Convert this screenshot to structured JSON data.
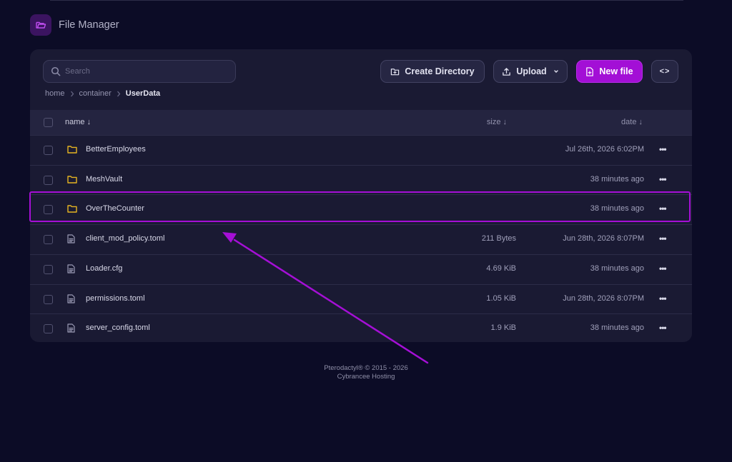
{
  "header": {
    "title": "File Manager",
    "icon": "folder-open-icon"
  },
  "search": {
    "placeholder": "Search",
    "value": ""
  },
  "toolbar": {
    "create_directory_label": "Create Directory",
    "upload_label": "Upload",
    "new_file_label": "New file",
    "code_toggle_label": "<>"
  },
  "breadcrumb": {
    "items": [
      "home",
      "container"
    ],
    "current": "UserData"
  },
  "table": {
    "columns": {
      "name": "name ↓",
      "size": "size ↓",
      "date": "date ↓"
    },
    "rows": [
      {
        "type": "folder",
        "name": "BetterEmployees",
        "size": "",
        "date": "Jul 26th, 2026 6:02PM",
        "actions": "•••"
      },
      {
        "type": "folder",
        "name": "MeshVault",
        "size": "",
        "date": "38 minutes ago",
        "actions": "•••"
      },
      {
        "type": "folder",
        "name": "OverTheCounter",
        "size": "",
        "date": "38 minutes ago",
        "actions": "•••",
        "highlighted": true
      },
      {
        "type": "file",
        "name": "client_mod_policy.toml",
        "size": "211 Bytes",
        "date": "Jun 28th, 2026 8:07PM",
        "actions": "•••"
      },
      {
        "type": "file",
        "name": "Loader.cfg",
        "size": "4.69 KiB",
        "date": "38 minutes ago",
        "actions": "•••"
      },
      {
        "type": "file",
        "name": "permissions.toml",
        "size": "1.05 KiB",
        "date": "Jun 28th, 2026 8:07PM",
        "actions": "•••"
      },
      {
        "type": "file",
        "name": "server_config.toml",
        "size": "1.9 KiB",
        "date": "38 minutes ago",
        "actions": "•••"
      }
    ]
  },
  "footer": {
    "line1": "Pterodactyl® © 2015 - 2026",
    "line2": "Cybrancee Hosting"
  },
  "colors": {
    "background": "#0c0c26",
    "panel": "#1a1a33",
    "accent": "#a30fd6",
    "folder": "#e6b422"
  }
}
